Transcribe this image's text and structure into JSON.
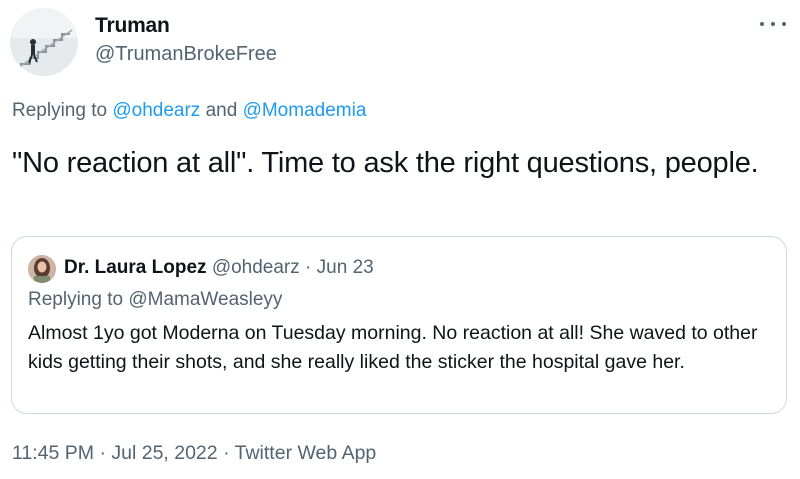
{
  "author": {
    "display_name": "Truman",
    "handle": "@TrumanBrokeFree"
  },
  "icons": {
    "avatar": "staircase-photo-avatar",
    "more": "more-options-icon"
  },
  "reply_context": {
    "prefix": "Replying to ",
    "mention_1": "@ohdearz",
    "joiner": " and ",
    "mention_2": "@Momademia"
  },
  "tweet_text": "\"No reaction at all\". Time to ask the right questions, people.",
  "quoted_tweet": {
    "display_name": "Dr. Laura Lopez",
    "handle": "@ohdearz",
    "separator": "·",
    "date": "Jun 23",
    "replying_prefix": "Replying to ",
    "replying_mention": "@MamaWeasleyy",
    "text": "Almost 1yo got Moderna on Tuesday morning. No reaction at all! She waved to other kids getting their shots, and she really liked the sticker the hospital gave her."
  },
  "meta": {
    "time": "11:45 PM",
    "sep_1": "·",
    "date": "Jul 25, 2022",
    "sep_2": "·",
    "source": "Twitter Web App"
  },
  "colors": {
    "text_primary": "#0f1419",
    "text_secondary": "#536471",
    "link": "#1d9bf0",
    "border": "#cfd9de"
  }
}
